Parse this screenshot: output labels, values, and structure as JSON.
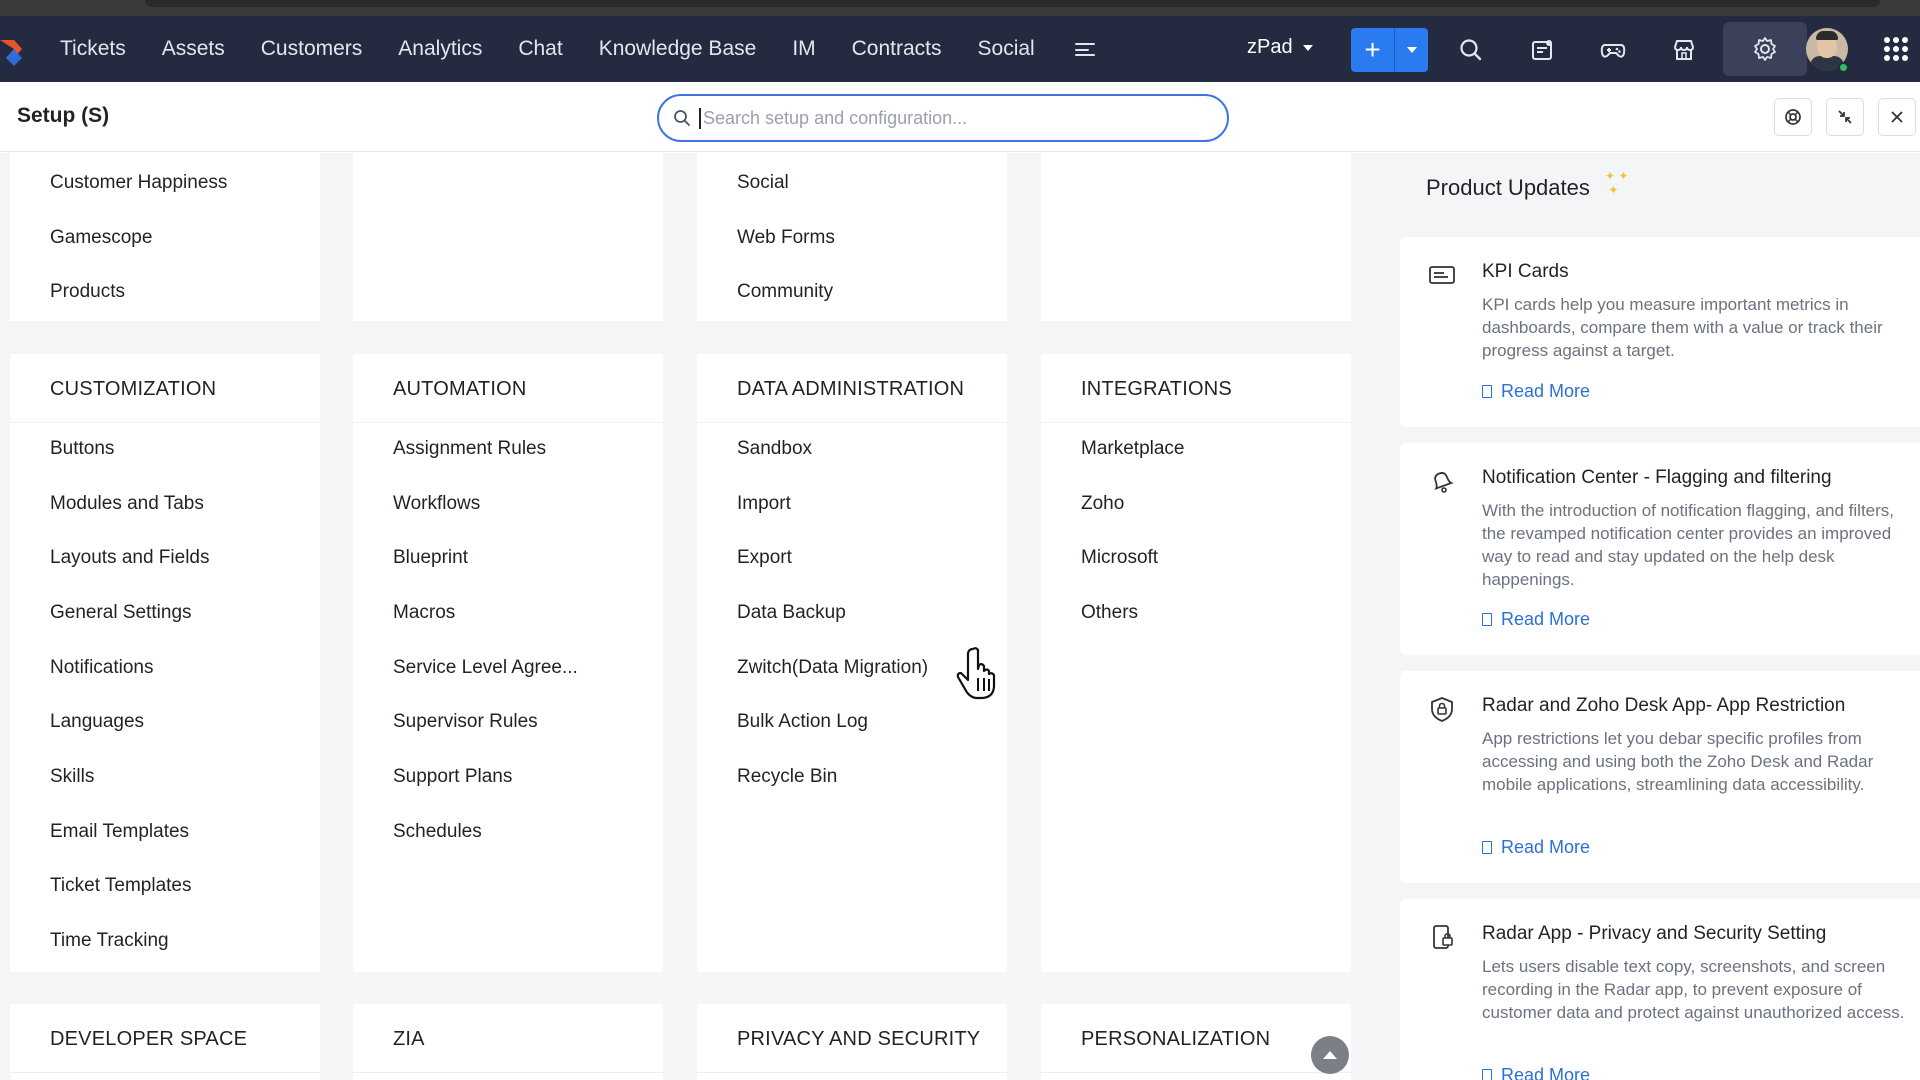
{
  "nav": {
    "items": [
      "Tickets",
      "Assets",
      "Customers",
      "Analytics",
      "Chat",
      "Knowledge Base",
      "IM",
      "Contracts",
      "Social"
    ],
    "department": "zPad",
    "add_label": "+"
  },
  "setup": {
    "title": "Setup (S)",
    "search_placeholder": "Search setup and configuration..."
  },
  "cards": {
    "top_left": [
      "Customer Happiness",
      "Gamescope",
      "Products"
    ],
    "top_mid": [
      "Social",
      "Web Forms",
      "Community"
    ],
    "customization": {
      "title": "CUSTOMIZATION",
      "items": [
        "Buttons",
        "Modules and Tabs",
        "Layouts and Fields",
        "General Settings",
        "Notifications",
        "Languages",
        "Skills",
        "Email Templates",
        "Ticket Templates",
        "Time Tracking"
      ]
    },
    "automation": {
      "title": "AUTOMATION",
      "items": [
        "Assignment Rules",
        "Workflows",
        "Blueprint",
        "Macros",
        "Service Level Agree...",
        "Supervisor Rules",
        "Support Plans",
        "Schedules"
      ]
    },
    "data_admin": {
      "title": "DATA ADMINISTRATION",
      "items": [
        "Sandbox",
        "Import",
        "Export",
        "Data Backup",
        "Zwitch(Data Migration)",
        "Bulk Action Log",
        "Recycle Bin"
      ]
    },
    "integrations": {
      "title": "INTEGRATIONS",
      "items": [
        "Marketplace",
        "Zoho",
        "Microsoft",
        "Others"
      ]
    },
    "bottom": [
      "DEVELOPER SPACE",
      "ZIA",
      "PRIVACY AND SECURITY",
      "PERSONALIZATION"
    ]
  },
  "updates": {
    "title": "Product Updates",
    "read_more": "Read More",
    "items": [
      {
        "title": "KPI Cards",
        "desc": "KPI cards help you measure important metrics in dashboards, compare them with a value or track their progress against a target."
      },
      {
        "title": "Notification Center - Flagging and filtering",
        "desc": "With the introduction of notification flagging, and filters, the revamped notification center provides an improved way to read and stay updated on the help desk happenings."
      },
      {
        "title": "Radar and Zoho Desk App- App Restriction",
        "desc": "App restrictions let you debar specific profiles from accessing and using both the Zoho Desk and Radar mobile applications, streamlining data accessibility."
      },
      {
        "title": "Radar App - Privacy and Security Setting",
        "desc": "Lets users disable text copy, screenshots, and screen recording in the Radar app, to prevent exposure of customer data and protect against unauthorized access."
      }
    ]
  },
  "colors": {
    "nav_bg": "#242b40",
    "accent": "#2a7bf0",
    "link": "#2c6fd9"
  },
  "icons": [
    "logo-icon",
    "menu-more-icon",
    "search-icon",
    "compose-icon",
    "gamepad-icon",
    "store-icon",
    "gear-icon",
    "apps-grid-icon",
    "help-icon",
    "collapse-icon",
    "close-icon",
    "kpi-card-icon",
    "bell-icon",
    "shield-lock-icon",
    "phone-lock-icon",
    "scroll-top-icon",
    "hand-cursor-icon"
  ]
}
